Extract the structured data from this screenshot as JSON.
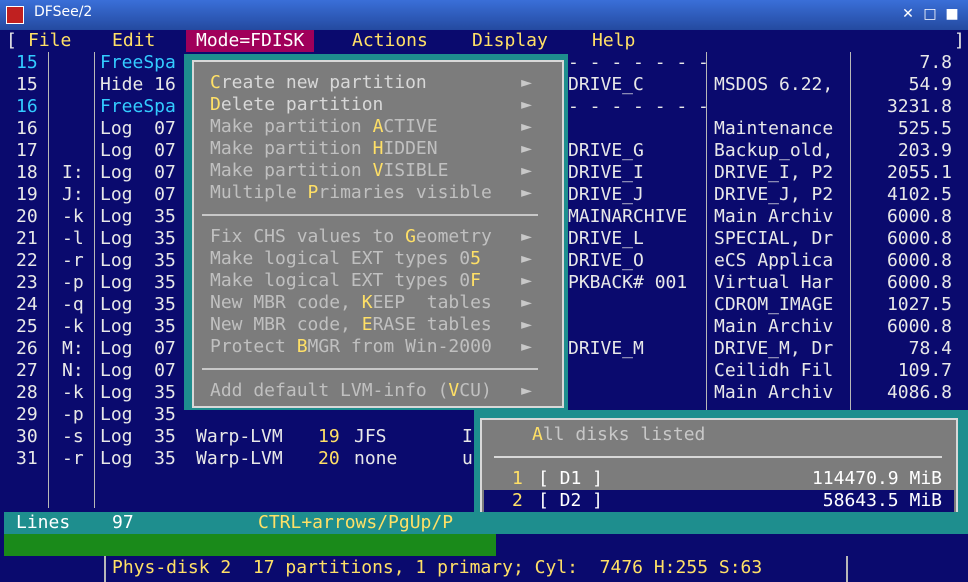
{
  "window": {
    "title": "DFSee/2",
    "close_glyph": "✕",
    "restore_glyph": "□",
    "max_glyph": "■"
  },
  "menubar": {
    "bracket_left": "[",
    "bracket_right": "]",
    "items": [
      "File",
      "Edit",
      "Mode=FDISK",
      "Actions",
      "Display",
      "Help"
    ]
  },
  "table": {
    "rows": [
      {
        "id": "15",
        "drv": "",
        "type": "FreeSpa",
        "fs": "",
        "label": "- - - - - - -",
        "desc": "",
        "size": "7.8",
        "highlight": true
      },
      {
        "id": "15",
        "drv": "",
        "type": "Hide 16",
        "fs": "",
        "label": "DRIVE_C",
        "desc": "MSDOS 6.22,",
        "size": "54.9",
        "highlight": false
      },
      {
        "id": "16",
        "drv": "",
        "type": "FreeSpa",
        "fs": "",
        "label": "- - - - - - -",
        "desc": "",
        "size": "3231.8",
        "highlight": true
      },
      {
        "id": "16",
        "drv": "",
        "type": "Log  07",
        "fs": "",
        "label": "",
        "desc": "Maintenance",
        "size": "525.5",
        "highlight": false
      },
      {
        "id": "17",
        "drv": "",
        "type": "Log  07",
        "fs": "",
        "label": "DRIVE_G",
        "desc": "Backup_old,",
        "size": "203.9",
        "highlight": false
      },
      {
        "id": "18",
        "drv": "I:",
        "type": "Log  07",
        "fs": "",
        "label": "DRIVE_I",
        "desc": "DRIVE_I, P2",
        "size": "2055.1",
        "highlight": false
      },
      {
        "id": "19",
        "drv": "J:",
        "type": "Log  07",
        "fs": "",
        "label": "DRIVE_J",
        "desc": "DRIVE_J, P2",
        "size": "4102.5",
        "highlight": false
      },
      {
        "id": "20",
        "drv": "-k",
        "type": "Log  35",
        "fs": "",
        "label": "MAINARCHIVE",
        "desc": "Main Archiv",
        "size": "6000.8",
        "highlight": false
      },
      {
        "id": "21",
        "drv": "-l",
        "type": "Log  35",
        "fs": "",
        "label": "DRIVE_L",
        "desc": "SPECIAL, Dr",
        "size": "6000.8",
        "highlight": false
      },
      {
        "id": "22",
        "drv": "-r",
        "type": "Log  35",
        "fs": "",
        "label": "DRIVE_O",
        "desc": "eCS Applica",
        "size": "6000.8",
        "highlight": false
      },
      {
        "id": "23",
        "drv": "-p",
        "type": "Log  35",
        "fs": "",
        "label": "PKBACK# 001",
        "desc": "Virtual Har",
        "size": "6000.8",
        "highlight": false
      },
      {
        "id": "24",
        "drv": "-q",
        "type": "Log  35",
        "fs": "",
        "label": "",
        "desc": "CDROM_IMAGE",
        "size": "1027.5",
        "highlight": false
      },
      {
        "id": "25",
        "drv": "-k",
        "type": "Log  35",
        "fs": "",
        "label": "",
        "desc": "Main Archiv",
        "size": "6000.8",
        "highlight": false
      },
      {
        "id": "26",
        "drv": "M:",
        "type": "Log  07",
        "fs": "",
        "label": "DRIVE_M",
        "desc": "DRIVE_M, Dr",
        "size": "78.4",
        "highlight": false
      },
      {
        "id": "27",
        "drv": "N:",
        "type": "Log  07",
        "fs": "",
        "label": "",
        "desc": "Ceilidh Fil",
        "size": "109.7",
        "highlight": false
      },
      {
        "id": "28",
        "drv": "-k",
        "type": "Log  35",
        "fs": "",
        "label": "",
        "desc": "Main Archiv",
        "size": "4086.8",
        "highlight": false
      },
      {
        "id": "29",
        "drv": "-p",
        "type": "Log  35",
        "fs": "",
        "label": "",
        "desc": "",
        "size": "",
        "highlight": false
      },
      {
        "id": "30",
        "drv": "-s",
        "type": "Log  35",
        "fs": "Warp-LVM",
        "num": "19",
        "fsname": "JFS",
        "extra": "I",
        "label": "",
        "desc": "",
        "size": "",
        "highlight": false
      },
      {
        "id": "31",
        "drv": "-r",
        "type": "Log  35",
        "fs": "Warp-LVM",
        "num": "20",
        "fsname": "none",
        "extra": "u",
        "label": "",
        "desc": "",
        "size": "",
        "highlight": false
      }
    ]
  },
  "dropdown": {
    "items": [
      {
        "pre": "",
        "hk": "C",
        "post": "reate new partition",
        "enabled": true
      },
      {
        "pre": "",
        "hk": "D",
        "post": "elete partition",
        "enabled": true
      },
      {
        "pre": "Make partition ",
        "hk": "A",
        "post": "CTIVE",
        "enabled": false
      },
      {
        "pre": "Make partition ",
        "hk": "H",
        "post": "IDDEN",
        "enabled": false
      },
      {
        "pre": "Make partition ",
        "hk": "V",
        "post": "ISIBLE",
        "enabled": false
      },
      {
        "pre": "Multiple ",
        "hk": "P",
        "post": "rimaries visible",
        "enabled": false
      },
      {
        "pre": "Fix CHS values to ",
        "hk": "G",
        "post": "eometry",
        "enabled": false
      },
      {
        "pre": "Make logical EXT types 0",
        "hk": "5",
        "post": "",
        "enabled": false
      },
      {
        "pre": "Make logical EXT types 0",
        "hk": "F",
        "post": "",
        "enabled": false
      },
      {
        "pre": "New MBR code, ",
        "hk": "K",
        "post": "EEP  tables",
        "enabled": false
      },
      {
        "pre": "New MBR code, ",
        "hk": "E",
        "post": "RASE tables",
        "enabled": false
      },
      {
        "pre": "Protect ",
        "hk": "B",
        "post": "MGR from Win-2000",
        "enabled": false
      },
      {
        "pre": "Add default LVM-info (",
        "hk": "V",
        "post": "CU)",
        "enabled": false
      }
    ],
    "arrow": "►"
  },
  "disks": {
    "header_hk": "A",
    "header_rest": "ll disks listed",
    "items": [
      {
        "num": "1",
        "name": "[ D1 ]",
        "size": "114470.9 MiB",
        "selected": false
      },
      {
        "num": "2",
        "name": "[ D2 ]",
        "size": "58643.5 MiB",
        "selected": true
      }
    ]
  },
  "status": {
    "lines_label": "Lines",
    "lines_value": "97",
    "hint": "CTRL+arrows/PgUp/P",
    "phys": "Phys-disk 2  17 partitions, 1 primary; Cyl:  7476 H:255 S:63"
  },
  "colors": {
    "bg": "#0a0a6e",
    "teal": "#1e8e8e",
    "gray": "#7c7c7c",
    "yellow": "#ffe066",
    "cyan": "#33ccff",
    "magenta": "#a0005a"
  }
}
